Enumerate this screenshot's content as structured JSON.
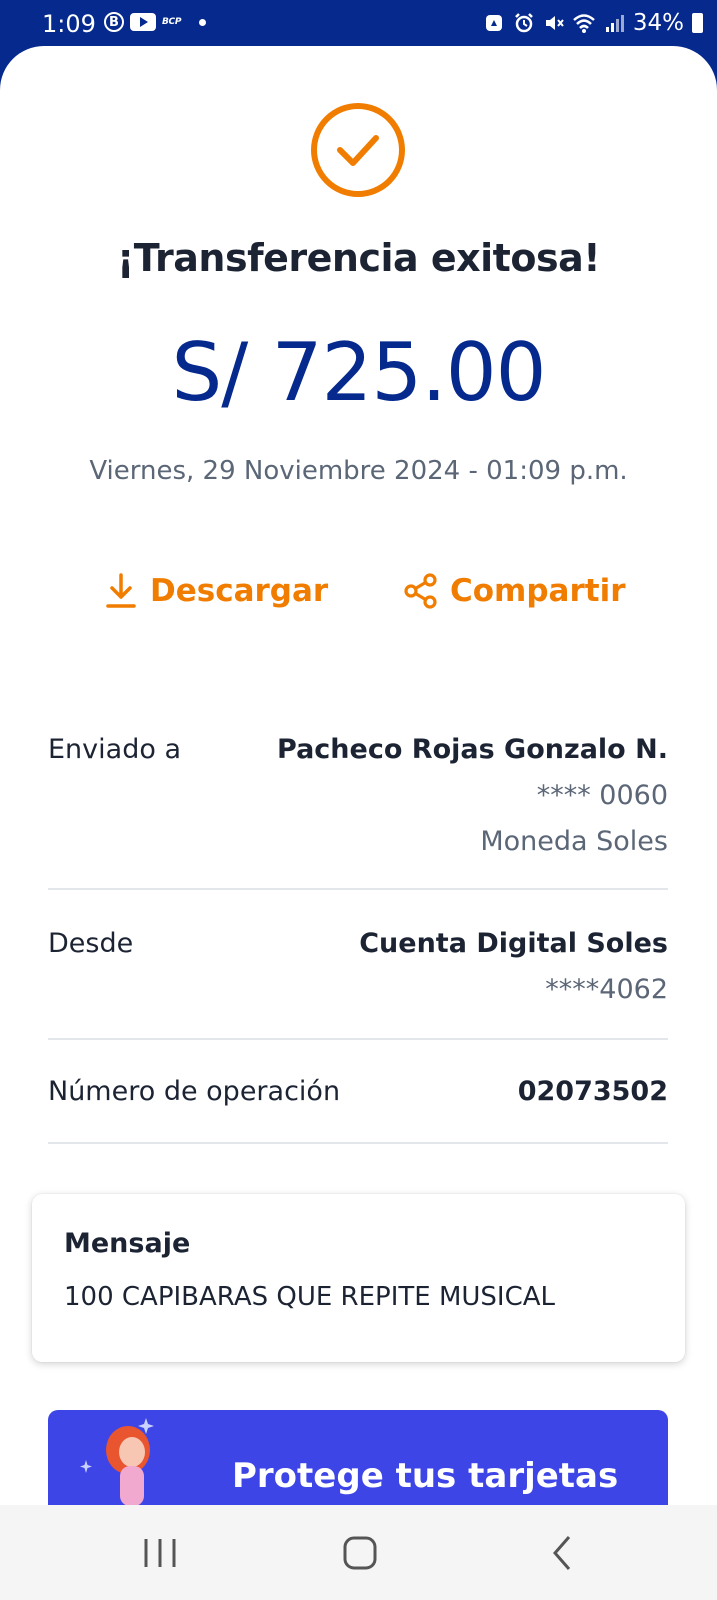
{
  "status_bar": {
    "time": "1:09",
    "b_badge": "B",
    "bcp_label": "BCP",
    "battery": "34%",
    "icons": [
      "b-circle-icon",
      "youtube-icon",
      "bcp-icon",
      "dot-icon",
      "recycle-icon",
      "alarm-icon",
      "mute-icon",
      "wifi-icon",
      "signal-icon",
      "battery-icon"
    ]
  },
  "receipt": {
    "title": "¡Transferencia exitosa!",
    "amount": "S/ 725.00",
    "datetime": "Viernes, 29 Noviembre 2024 - 01:09 p.m."
  },
  "actions": {
    "download_label": "Descargar",
    "share_label": "Compartir"
  },
  "details": {
    "sent_to": {
      "label": "Enviado a",
      "name": "Pacheco Rojas Gonzalo N.",
      "account": "**** 0060",
      "currency": "Moneda Soles"
    },
    "from": {
      "label": "Desde",
      "account_name": "Cuenta Digital Soles",
      "account": "****4062"
    },
    "operation": {
      "label": "Número de operación",
      "number": "02073502"
    }
  },
  "message": {
    "title": "Mensaje",
    "body": "100 CAPIBARAS QUE REPITE MUSICAL"
  },
  "promo": {
    "text": "Protege tus tarjetas"
  },
  "colors": {
    "brand_blue": "#05298c",
    "accent_orange": "#f07d00",
    "promo_blue": "#3d45e6",
    "text_dark": "#1c2434",
    "text_muted": "#5b6677"
  },
  "navbar": {
    "icons": [
      "recents-icon",
      "home-icon",
      "back-icon"
    ]
  }
}
